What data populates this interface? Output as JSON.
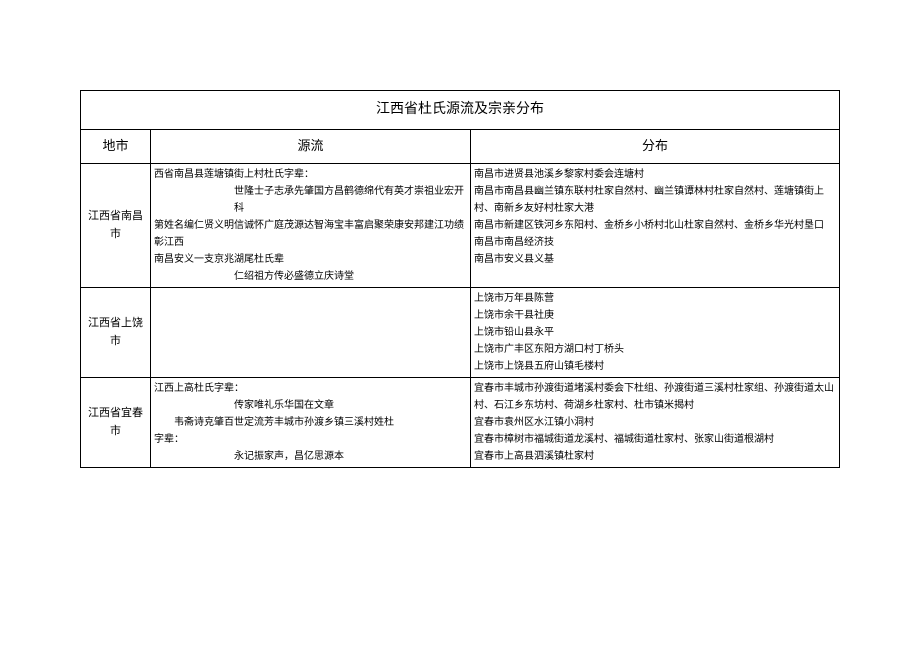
{
  "title": "江西省杜氏源流及宗亲分布",
  "headers": {
    "city": "地市",
    "source": "源流",
    "distribution": "分布"
  },
  "rows": [
    {
      "city": "江西省南昌市",
      "source_lines": [
        "西省南昌县莲塘镇街上村杜氏字辈：",
        "世隆士子志承先肇国方昌鹤德绵代有英才崇祖业宏开科",
        "第姓名编仁贤义明信诚怀广庭茂源达智海宝丰富启聚荣康安邦建江功绩彰江西",
        "南昌安义一支京兆湖尾杜氏辈",
        "仁绍祖方传必盛德立庆诗堂"
      ],
      "source_indents": [
        "",
        "indent-line",
        "",
        "",
        "indent-line"
      ],
      "dist_lines": [
        "南昌市进贤县池溪乡黎家村委会连塘村",
        "南昌市南昌县幽兰镇东联村杜家自然村、幽兰镇谭林村杜家自然村、莲塘镇街上村、南新乡友好村杜家大港",
        "南昌市新建区铁河乡东阳村、金桥乡小桥村北山杜家自然村、金桥乡华光村垦口",
        "南昌市南昌经济技",
        "南昌市安义县义基"
      ]
    },
    {
      "city": "江西省上饶市",
      "source_lines": [],
      "source_indents": [],
      "dist_lines": [
        "上饶市万年县陈营",
        "上饶市余干县社庚",
        "上饶市铅山县永平",
        "上饶市广丰区东阳方湖口村丁桥头",
        "上饶市上饶县五府山镇毛楼村"
      ]
    },
    {
      "city": "江西省宜春市",
      "source_lines": [
        "江西上高杜氏字辈：",
        "传家唯礼乐华国在文章",
        "韦斋诗克肇百世定流芳丰城市孙渡乡镇三溪村姓杜",
        "字辈：",
        "永记振家声，昌亿思源本"
      ],
      "source_indents": [
        "",
        "indent-line",
        "small-indent",
        "",
        "indent-line"
      ],
      "dist_lines": [
        "宜春市丰城市孙渡街道堵溪村委会下杜组、孙渡街道三溪村杜家组、孙渡街道太山村、石江乡东坊村、荷湖乡杜家村、杜市镇米揭村",
        "宜春市袁州区水江镇小洞村",
        "宜春市樟树市福城街道龙溪村、福城街道杜家村、张家山街道根湖村",
        "宜春市上高县泗溪镇杜家村"
      ]
    }
  ]
}
